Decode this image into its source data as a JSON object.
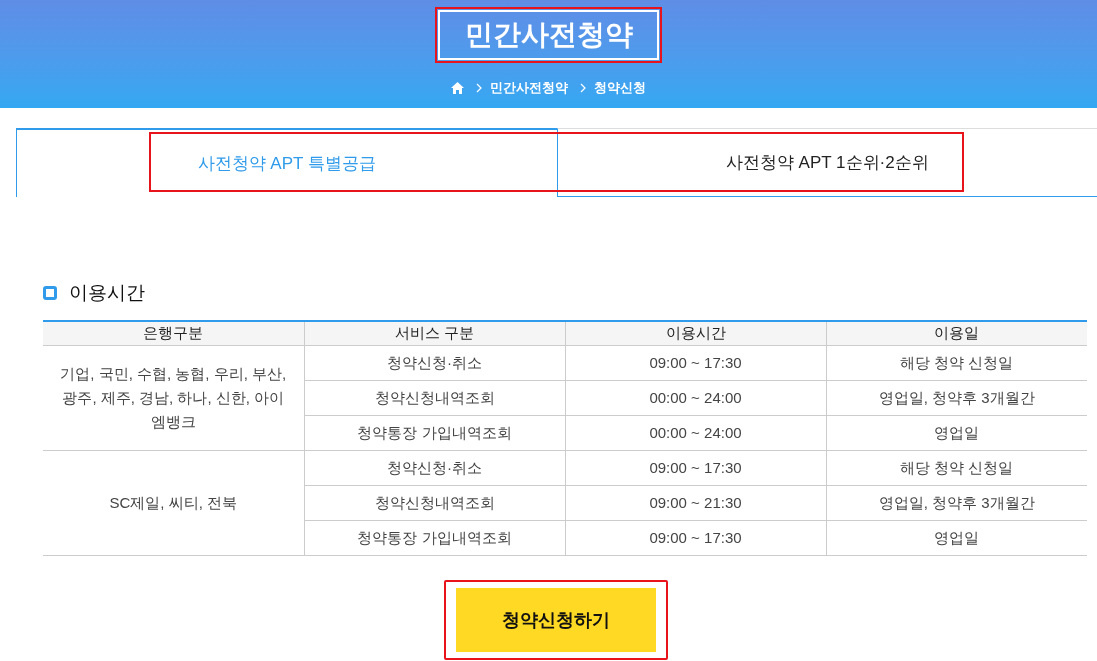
{
  "header": {
    "title": "민간사전청약",
    "breadcrumb": [
      "민간사전청약",
      "청약신청"
    ]
  },
  "tabs": [
    {
      "label": "사전청약 APT 특별공급",
      "selected": true
    },
    {
      "label": "사전청약 APT 1순위·2순위",
      "selected": false
    }
  ],
  "section": {
    "title": "이용시간"
  },
  "table": {
    "columns": [
      "은행구분",
      "서비스 구분",
      "이용시간",
      "이용일"
    ],
    "groups": [
      {
        "banks": "기업, 국민, 수협, 농협, 우리, 부산, 광주, 제주, 경남, 하나, 신한, 아이엠뱅크",
        "rows": [
          [
            "청약신청·취소",
            "09:00 ~ 17:30",
            "해당 청약 신청일"
          ],
          [
            "청약신청내역조회",
            "00:00 ~ 24:00",
            "영업일, 청약후 3개월간"
          ],
          [
            "청약통장 가입내역조회",
            "00:00 ~ 24:00",
            "영업일"
          ]
        ]
      },
      {
        "banks": "SC제일, 씨티, 전북",
        "rows": [
          [
            "청약신청·취소",
            "09:00 ~ 17:30",
            "해당 청약 신청일"
          ],
          [
            "청약신청내역조회",
            "09:00 ~ 21:30",
            "영업일, 청약후 3개월간"
          ],
          [
            "청약통장 가입내역조회",
            "09:00 ~ 17:30",
            "영업일"
          ]
        ]
      }
    ]
  },
  "button": {
    "label": "청약신청하기"
  }
}
